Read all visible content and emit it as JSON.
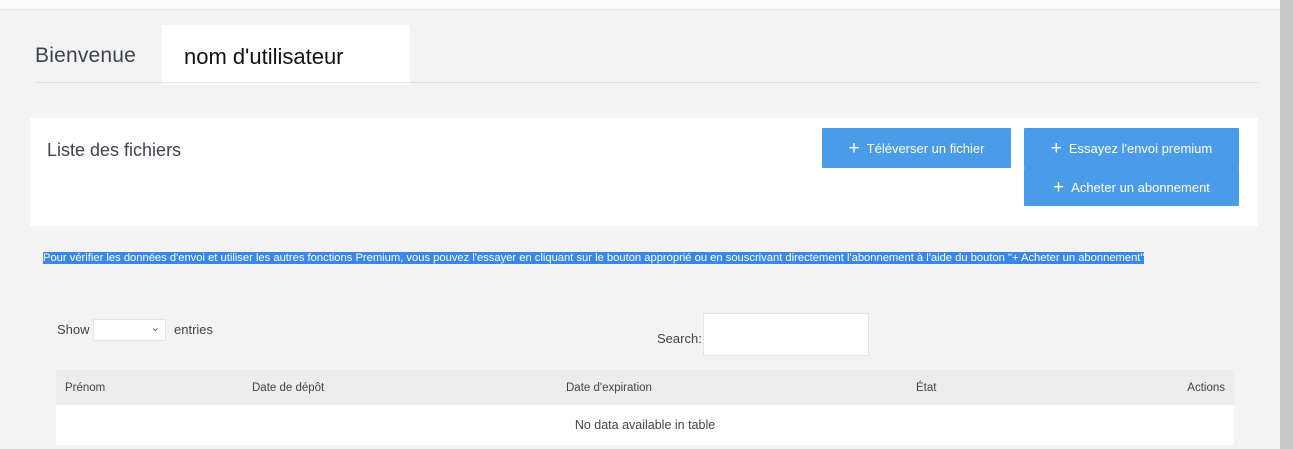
{
  "header": {
    "welcome_label": "Bienvenue",
    "username": "nom d'utilisateur"
  },
  "files_card": {
    "title": "Liste des fichiers",
    "upload_label": "Téléverser un fichier",
    "premium_trial_label": "Essayez l'envoi premium",
    "subscribe_label": "Acheter un abonnement"
  },
  "notice": "Pour vérifier les données d'envoi et utiliser les autres fonctions Premium, vous pouvez l'essayer en cliquant sur le bouton approprié ou en souscrivant directement l'abonnement à l'aide du bouton \"+ Acheter un abonnement\"",
  "table_controls": {
    "show_label": "Show",
    "entries_label": "entries",
    "entries_value": "",
    "search_label": "Search:",
    "search_value": ""
  },
  "table": {
    "columns": [
      "Prénom",
      "Date de dépôt",
      "Date d'expiration",
      "État",
      "Actions"
    ],
    "rows": [],
    "empty_message": "No data available in table"
  },
  "colors": {
    "accent": "#4a9be8",
    "selection": "#3a87e6",
    "page_bg": "#f3f3f3"
  }
}
